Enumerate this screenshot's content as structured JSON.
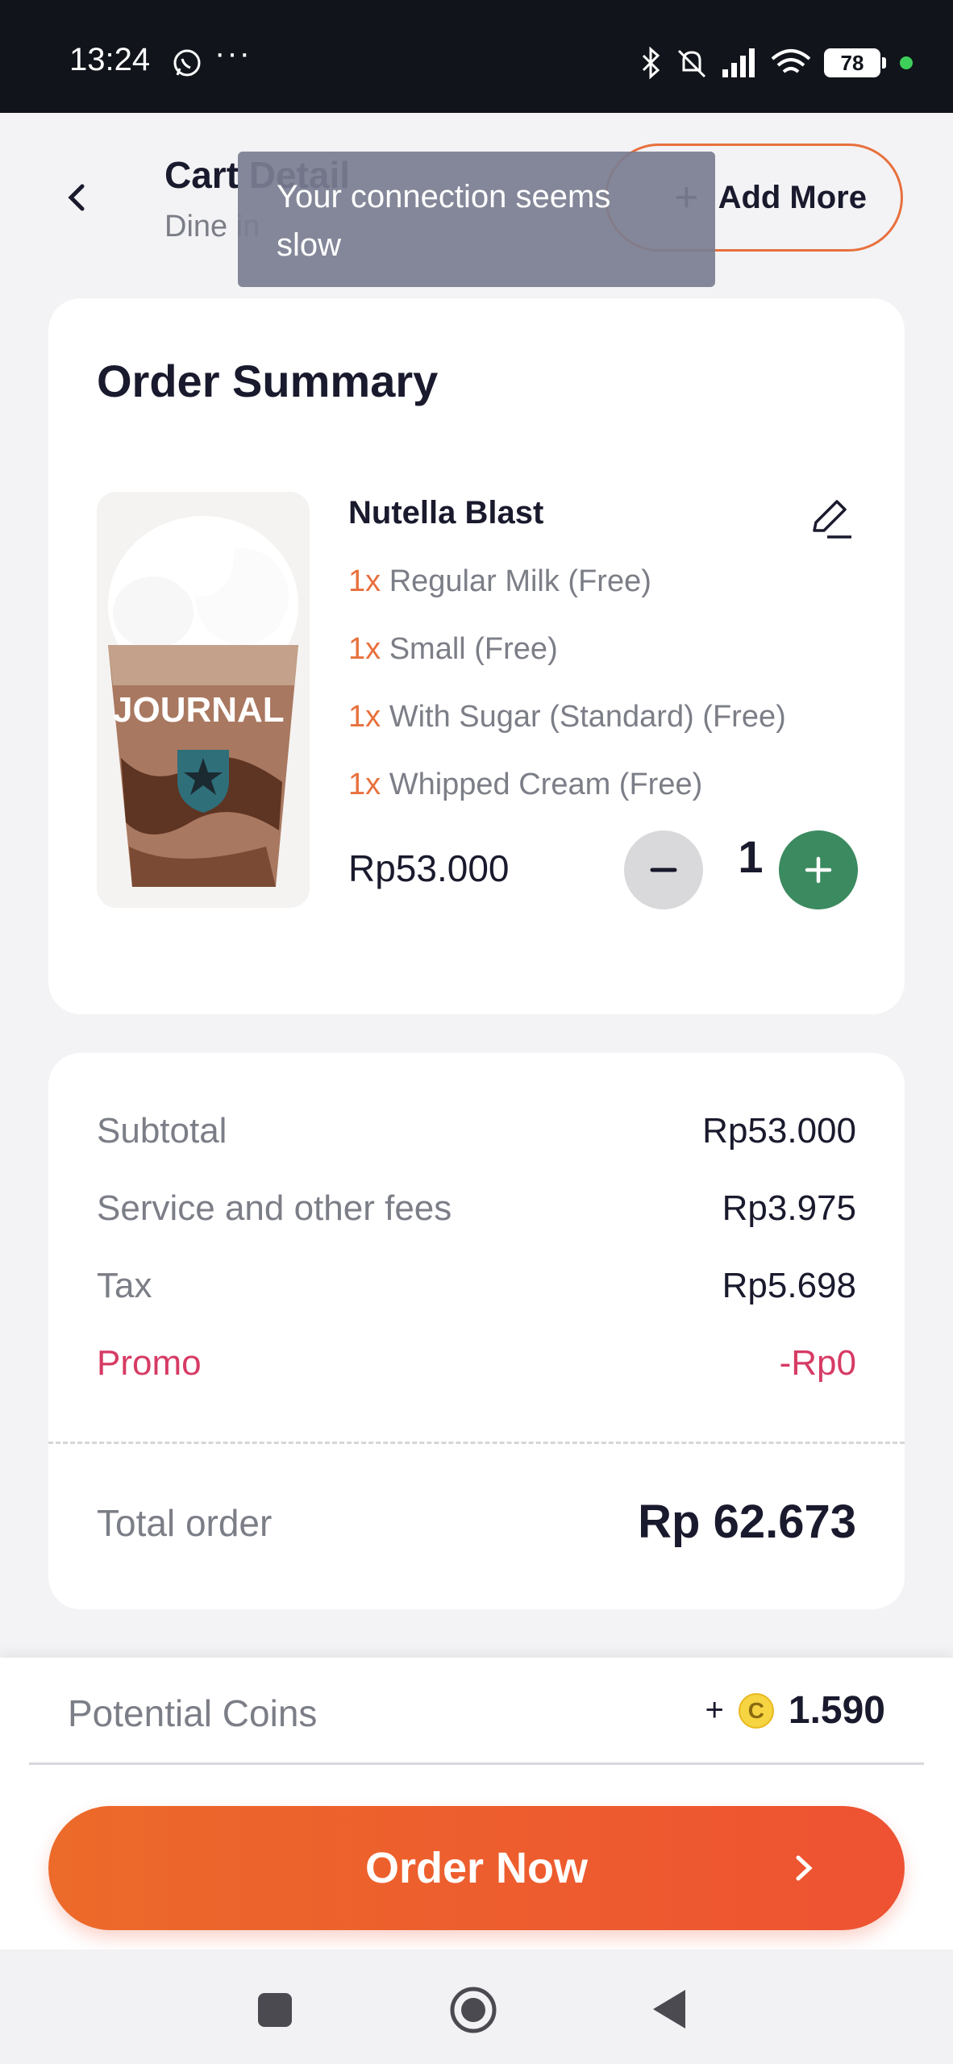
{
  "status_bar": {
    "time": "13:24",
    "dots": "···",
    "battery": "78"
  },
  "header": {
    "title": "Cart Detail",
    "subtitle": "Dine in",
    "add_more_plus": "+",
    "add_more_label": "Add More"
  },
  "toast": {
    "message": "Your connection seems slow"
  },
  "order_summary": {
    "title": "Order Summary",
    "item": {
      "name": "Nutella Blast",
      "image_text": "JOURNAL",
      "modifiers": [
        {
          "qty": "1x",
          "text": " Regular Milk (Free)"
        },
        {
          "qty": "1x",
          "text": " Small (Free)"
        },
        {
          "qty": "1x",
          "text": " With Sugar (Standard) (Free)"
        },
        {
          "qty": "1x",
          "text": " Whipped Cream (Free)"
        }
      ],
      "price": "Rp53.000",
      "quantity": "1"
    }
  },
  "summary": {
    "rows": [
      {
        "label": "Subtotal",
        "value": "Rp53.000"
      },
      {
        "label": "Service and other fees",
        "value": "Rp3.975"
      },
      {
        "label": "Tax",
        "value": "Rp5.698"
      },
      {
        "label": "Promo",
        "value": "-Rp0"
      }
    ],
    "total_label": "Total order",
    "total_value": "Rp 62.673"
  },
  "coins": {
    "label": "Potential Coins",
    "plus": "+",
    "coin_letter": "C",
    "amount": "1.590"
  },
  "order_button": {
    "label": "Order Now"
  },
  "colors": {
    "accent_orange": "#e8703d",
    "button_gradient_start": "#ec6a2a",
    "button_gradient_end": "#ee5232",
    "promo_red": "#d63b64",
    "plus_green": "#3b8a60"
  },
  "icons": [
    "whatsapp-icon",
    "bluetooth-icon",
    "mute-icon",
    "signal-icon",
    "wifi-icon",
    "back-chevron-icon",
    "edit-pencil-icon",
    "minus-icon",
    "plus-icon",
    "coin-icon",
    "chevron-right-icon"
  ]
}
